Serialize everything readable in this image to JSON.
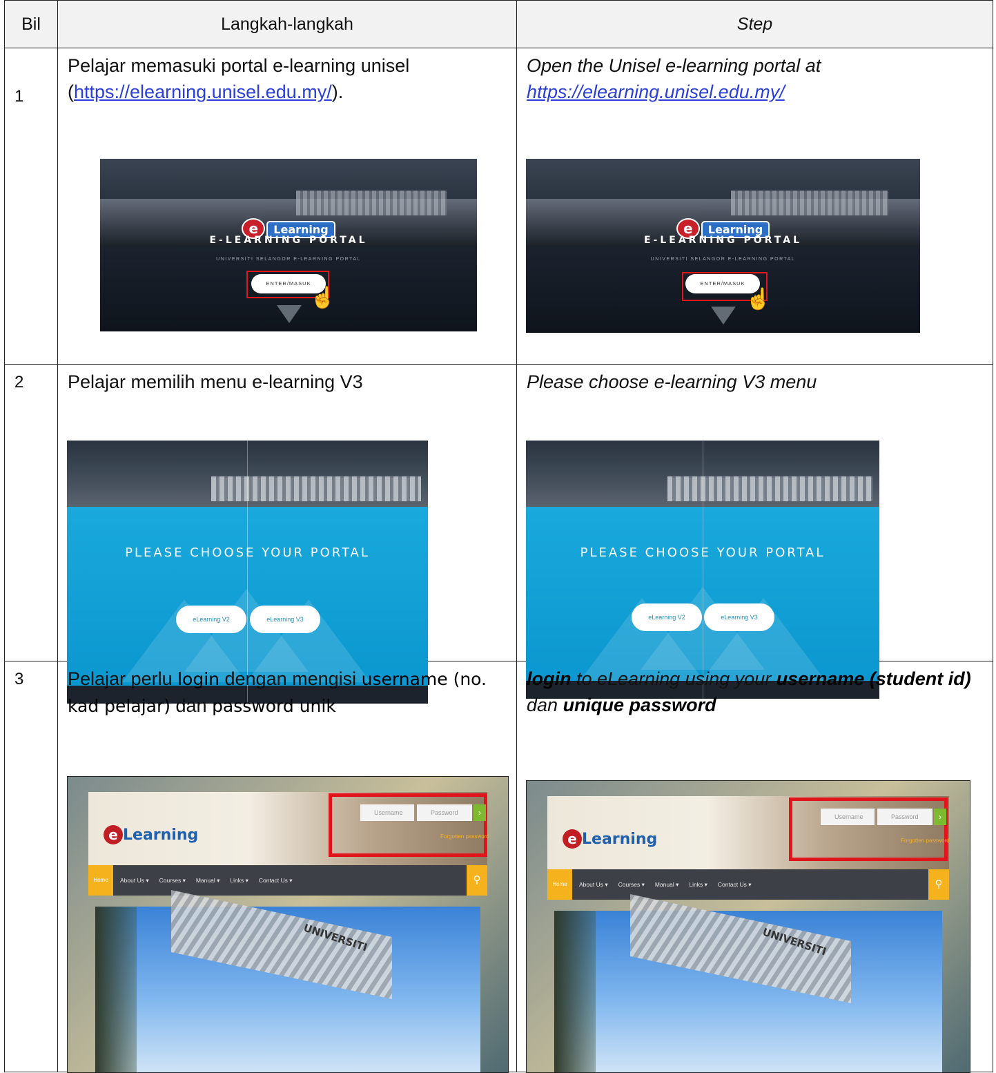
{
  "table": {
    "headers": {
      "bil": "Bil",
      "langkah": "Langkah-langkah",
      "step": "Step"
    },
    "rows": [
      {
        "no": "1",
        "ms_pre": "Pelajar memasuki portal e-learning unisel (",
        "ms_link": "https://elearning.unisel.edu.my/",
        "ms_post": ").",
        "en_pre": "Open the Unisel e-learning portal at",
        "en_link": "https://elearning.unisel.edu.my/"
      },
      {
        "no": "2",
        "ms": "Pelajar memilih menu e-learning V3",
        "en": "Please choose e-learning V3 menu"
      },
      {
        "no": "3",
        "ms_parts": [
          "Pelajar perlu ",
          "login",
          " dengan mengisi ",
          "username (no. kad pelajar)",
          " dan ",
          "password unik"
        ],
        "en_parts": [
          "login",
          " to eLearning using your ",
          "username (student id)",
          " dan ",
          "unique password"
        ]
      }
    ]
  },
  "portal_shot": {
    "logo_e": "e",
    "logo_word": "Learning",
    "title": "E-LEARNING PORTAL",
    "subtitle": "UNIVERSITI SELANGOR E-LEARNING PORTAL",
    "enter_button": "ENTER/MASUK"
  },
  "choose_shot": {
    "heading": "PLEASE CHOOSE YOUR PORTAL",
    "btn_v2": "eLearning V2",
    "btn_v3": "eLearning V3"
  },
  "login_shot": {
    "username_placeholder": "Username",
    "password_placeholder": "Password",
    "go": "›",
    "forgot": "Forgotten password",
    "nav_home": "Home",
    "nav": [
      "About Us ▾",
      "Courses ▾",
      "Manual ▾",
      "Links ▾",
      "Contact Us ▾"
    ],
    "search_icon": "search-icon",
    "sign": "UNIVERSITI",
    "logo_e": "e",
    "logo_word": "Learning"
  },
  "colors": {
    "highlight": "#e01818",
    "link": "#2a3fd8",
    "nav_accent": "#f5b21d",
    "portal_blue": "#0d9bd1"
  }
}
